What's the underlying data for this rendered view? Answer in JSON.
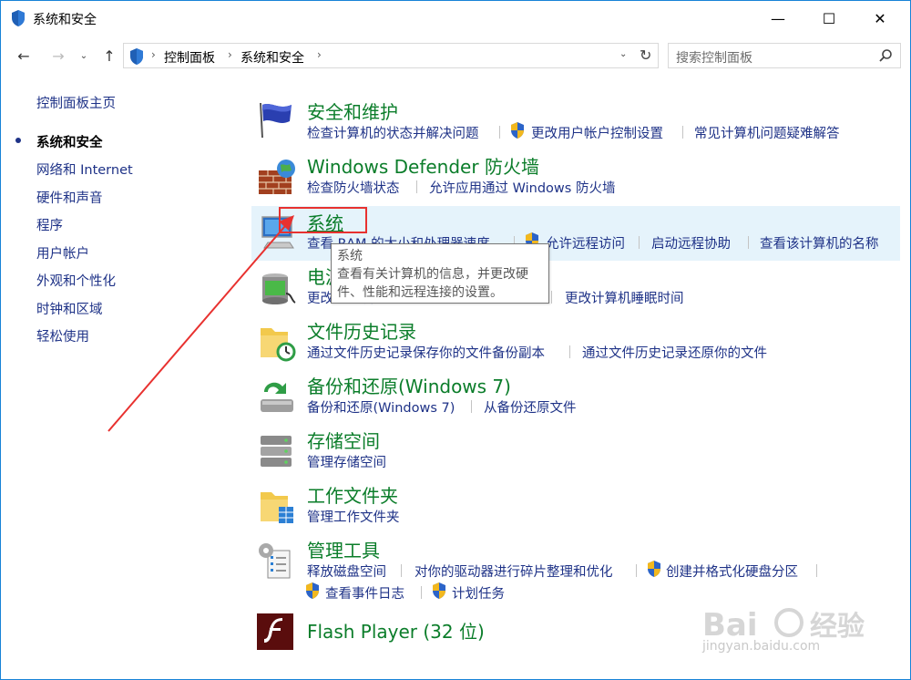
{
  "window": {
    "title": "系统和安全",
    "controls": {
      "minimize": "—",
      "maximize": "☐",
      "close": "✕"
    }
  },
  "navbar": {
    "back": "←",
    "forward": "→",
    "recent": "⌄",
    "up": "↑",
    "breadcrumbs": [
      "控制面板",
      "系统和安全"
    ],
    "separator": "›",
    "dropdown": "⌄",
    "refresh": "↻"
  },
  "search": {
    "placeholder": "搜索控制面板"
  },
  "left_nav": {
    "items": [
      {
        "label": "控制面板主页"
      },
      {
        "label": "系统和安全",
        "active": true
      },
      {
        "label": "网络和 Internet"
      },
      {
        "label": "硬件和声音"
      },
      {
        "label": "程序"
      },
      {
        "label": "用户帐户"
      },
      {
        "label": "外观和个性化"
      },
      {
        "label": "时钟和区域"
      },
      {
        "label": "轻松使用"
      }
    ]
  },
  "categories": {
    "security": {
      "title": "安全和维护",
      "links": [
        "检查计算机的状态并解决问题",
        "更改用户帐户控制设置",
        "常见计算机问题疑难解答"
      ]
    },
    "firewall": {
      "title": "Windows Defender 防火墙",
      "links": [
        "检查防火墙状态",
        "允许应用通过 Windows 防火墙"
      ]
    },
    "system": {
      "title": "系统",
      "links": [
        "查看 RAM 的大小和处理器速度",
        "允许远程访问",
        "启动远程协助",
        "查看该计算机的名称"
      ]
    },
    "power": {
      "title": "电源选项",
      "links": [
        "更改电池设置",
        "更改计算机睡眠时间"
      ]
    },
    "file_history": {
      "title": "文件历史记录",
      "links": [
        "通过文件历史记录保存你的文件备份副本",
        "通过文件历史记录还原你的文件"
      ]
    },
    "backup": {
      "title": "备份和还原(Windows 7)",
      "links": [
        "备份和还原(Windows 7)",
        "从备份还原文件"
      ]
    },
    "storage": {
      "title": "存储空间",
      "links": [
        "管理存储空间"
      ]
    },
    "work_folders": {
      "title": "工作文件夹",
      "links": [
        "管理工作文件夹"
      ]
    },
    "admin_tools": {
      "title": "管理工具",
      "links": [
        "释放磁盘空间",
        "对你的驱动器进行碎片整理和优化",
        "创建并格式化硬盘分区",
        "查看事件日志",
        "计划任务"
      ]
    },
    "flash": {
      "title": "Flash Player (32 位)"
    }
  },
  "tooltip": {
    "title": "系统",
    "line1": "查看有关计算机的信息，并更改硬",
    "line2": "件、性能和远程连接的设置。"
  },
  "watermark": {
    "text": "jingyan.baidu.com"
  },
  "colors": {
    "link": "#1e3287",
    "category_title": "#0b7d2a",
    "hover_bg": "#e5f3fb",
    "annotation": "#e8312f",
    "window_border": "#1883d7"
  }
}
